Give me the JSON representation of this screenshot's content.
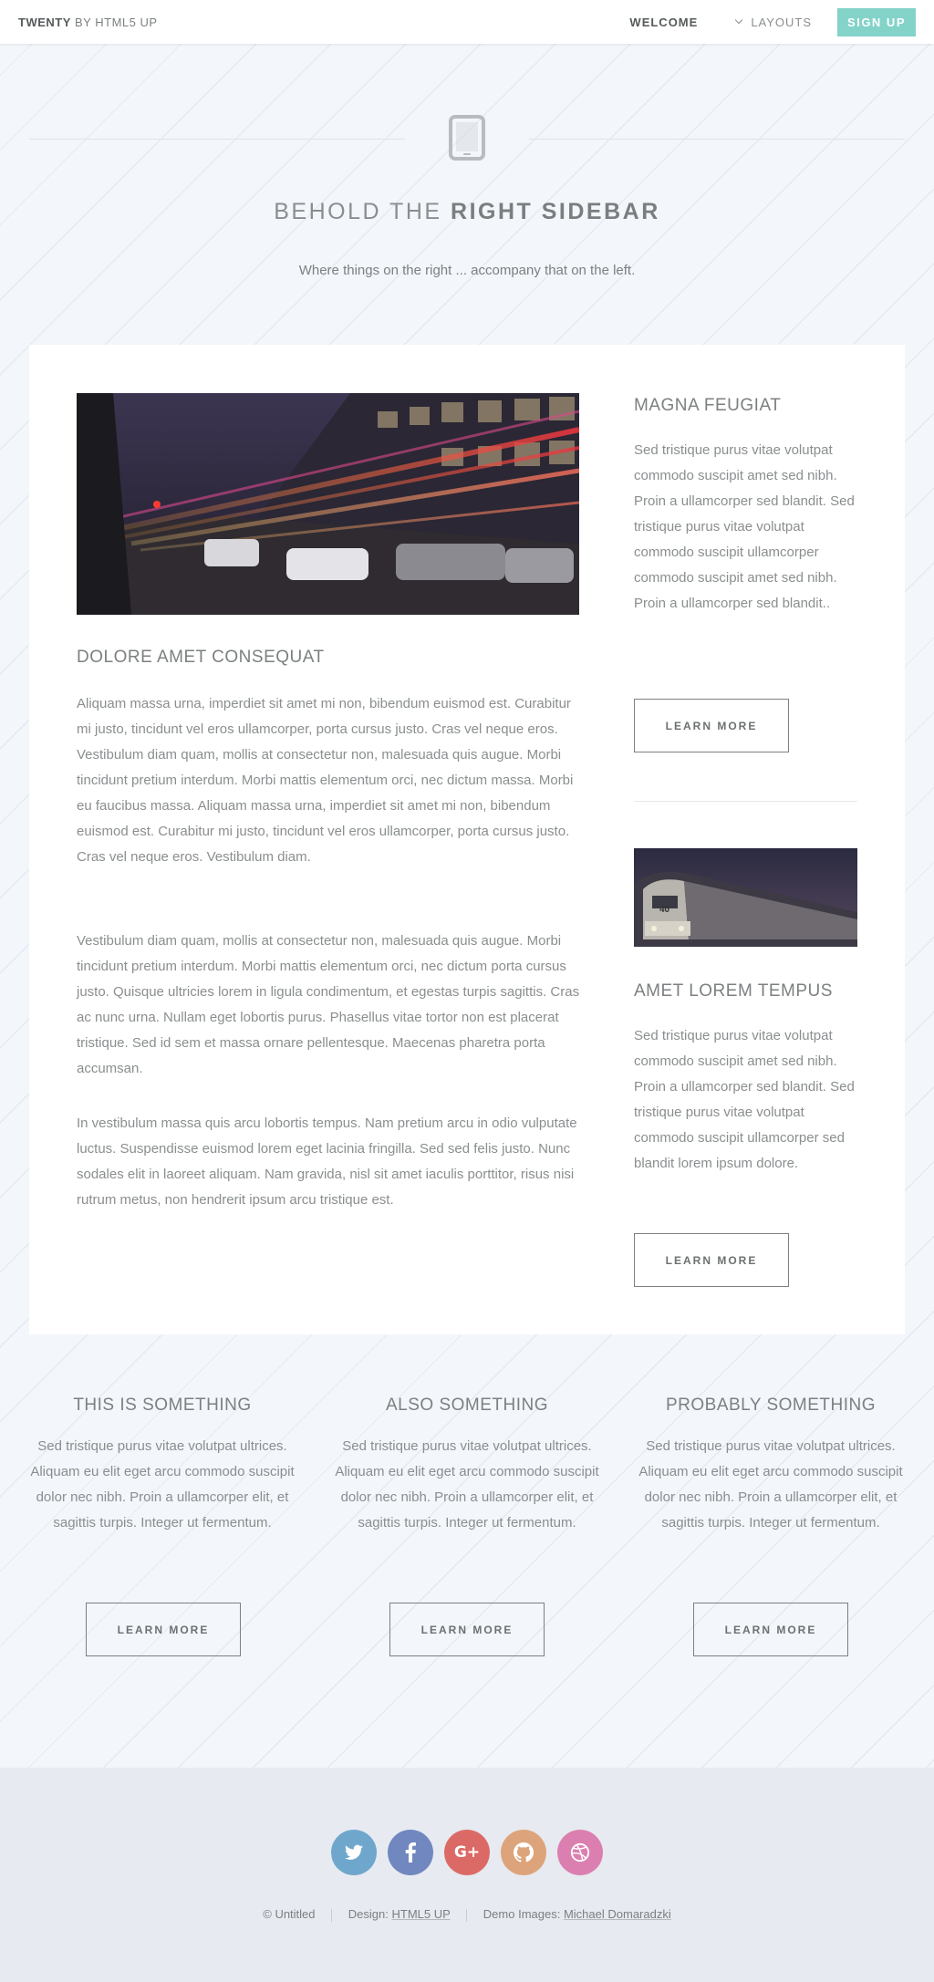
{
  "header": {
    "logo_bold": "TWENTY",
    "logo_rest": "BY HTML5 UP",
    "nav": {
      "welcome": "WELCOME",
      "layouts": "LAYOUTS",
      "signup": "SIGN UP"
    }
  },
  "banner": {
    "title_light": "BEHOLD THE",
    "title_strong": "RIGHT SIDEBAR",
    "subtitle": "Where things on the right ... accompany that on the left.",
    "icon": "tablet-icon"
  },
  "content": {
    "title": "DOLORE AMET CONSEQUAT",
    "paragraphs": [
      "Aliquam massa urna, imperdiet sit amet mi non, bibendum euismod est. Curabitur mi justo, tincidunt vel eros ullamcorper, porta cursus justo. Cras vel neque eros. Vestibulum diam quam, mollis at consectetur non, malesuada quis augue. Morbi tincidunt pretium interdum. Morbi mattis elementum orci, nec dictum massa. Morbi eu faucibus massa. Aliquam massa urna, imperdiet sit amet mi non, bibendum euismod est. Curabitur mi justo, tincidunt vel eros ullamcorper, porta cursus justo. Cras vel neque eros. Vestibulum diam.",
      "Vestibulum diam quam, mollis at consectetur non, malesuada quis augue. Morbi tincidunt pretium interdum. Morbi mattis elementum orci, nec dictum porta cursus justo. Quisque ultricies lorem in ligula condimentum, et egestas turpis sagittis. Cras ac nunc urna. Nullam eget lobortis purus. Phasellus vitae tortor non est placerat tristique. Sed id sem et massa ornare pellentesque. Maecenas pharetra porta accumsan.",
      "In vestibulum massa quis arcu lobortis tempus. Nam pretium arcu in odio vulputate luctus. Suspendisse euismod lorem eget lacinia fringilla. Sed sed felis justo. Nunc sodales elit in laoreet aliquam. Nam gravida, nisl sit amet iaculis porttitor, risus nisi rutrum metus, non hendrerit ipsum arcu tristique est."
    ]
  },
  "sidebar": [
    {
      "title": "MAGNA FEUGIAT",
      "text": "Sed tristique purus vitae volutpat commodo suscipit amet sed nibh. Proin a ullamcorper sed blandit. Sed tristique purus vitae volutpat commodo suscipit ullamcorper commodo suscipit amet sed nibh. Proin a ullamcorper sed blandit..",
      "button": "LEARN MORE"
    },
    {
      "title": "AMET LOREM TEMPUS",
      "text": "Sed tristique purus vitae volutpat commodo suscipit amet sed nibh. Proin a ullamcorper sed blandit. Sed tristique purus vitae volutpat commodo suscipit ullamcorper sed blandit lorem ipsum dolore.",
      "button": "LEARN MORE",
      "image_label": "40"
    }
  ],
  "features": [
    {
      "title": "THIS IS SOMETHING",
      "text": "Sed tristique purus vitae volutpat ultrices. Aliquam eu elit eget arcu commodo suscipit dolor nec nibh. Proin a ullamcorper elit, et sagittis turpis. Integer ut fermentum.",
      "button": "LEARN MORE"
    },
    {
      "title": "ALSO SOMETHING",
      "text": "Sed tristique purus vitae volutpat ultrices. Aliquam eu elit eget arcu commodo suscipit dolor nec nibh. Proin a ullamcorper elit, et sagittis turpis. Integer ut fermentum.",
      "button": "LEARN MORE"
    },
    {
      "title": "PROBABLY SOMETHING",
      "text": "Sed tristique purus vitae volutpat ultrices. Aliquam eu elit eget arcu commodo suscipit dolor nec nibh. Proin a ullamcorper elit, et sagittis turpis. Integer ut fermentum.",
      "button": "LEARN MORE"
    }
  ],
  "footer": {
    "social": [
      {
        "icon": "twitter-icon",
        "color": "#6fa7cc",
        "glyph": "t"
      },
      {
        "icon": "facebook-icon",
        "color": "#7187c0",
        "glyph": "f"
      },
      {
        "icon": "google-plus-icon",
        "color": "#db6a66",
        "glyph": "G+"
      },
      {
        "icon": "github-icon",
        "color": "#dda47b",
        "glyph": "◉"
      },
      {
        "icon": "dribbble-icon",
        "color": "#db7fb0",
        "glyph": "◍"
      }
    ],
    "copyright": "© Untitled",
    "design_label": "Design:",
    "design_link": "HTML5 UP",
    "images_label": "Demo Images:",
    "images_link": "Michael Domaradzki"
  },
  "colors": {
    "accent": "#83d3c9",
    "text": "#7c8081",
    "background": "#f3f6fa",
    "footer_bg": "#e7eaf0"
  }
}
